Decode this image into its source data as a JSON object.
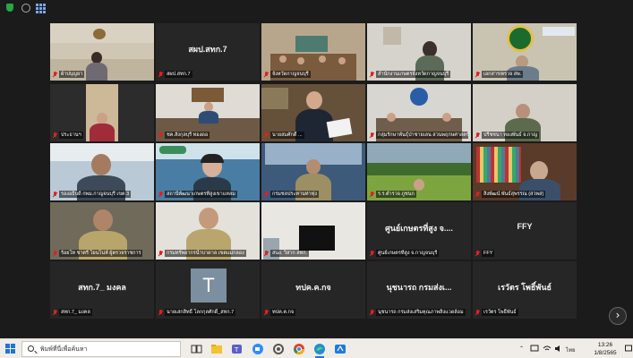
{
  "tiles": [
    {
      "caption": "ผ้าปบุญยา",
      "center": ""
    },
    {
      "caption": "สผป.สทก.7",
      "center": "สผป.สทก.7"
    },
    {
      "caption": "จังหวัดกาญจนบุรี",
      "center": ""
    },
    {
      "caption": "สำนักงานเกษตรจังหวัดกาญจนบุรี",
      "center": ""
    },
    {
      "caption": "เอกสาร/ตรวจ สพ.",
      "center": ""
    },
    {
      "caption": "ประธานฯ",
      "center": ""
    },
    {
      "caption": "ชค.สังกุลบุรี ทองดอ",
      "center": ""
    },
    {
      "caption": "นายสมศักดิ์ ...",
      "center": ""
    },
    {
      "caption": "กลุ่มรักษาพันธุ์ป่าชายเลน สวนพฤกษศาสตร์",
      "center": ""
    },
    {
      "caption": "ปรีชชนา ทองพันธ์ จ.กาญ",
      "center": ""
    },
    {
      "caption": "รองอธิบดี กพม.กาญจนบุรี เขต 3",
      "center": ""
    },
    {
      "caption": "สถานีพัฒนาเกษตรที่สูงเขาแหลม",
      "center": ""
    },
    {
      "caption": "กรมชลประทานท่าทุ่ง",
      "center": ""
    },
    {
      "caption": "ร.ร.ตำรวจ ภูชนก",
      "center": ""
    },
    {
      "caption": "สิงพัฒน์ พันธ์สุพรรณ (สวพส)",
      "center": ""
    },
    {
      "caption": "ร้อยโท ชาตรี โยนโน่ห์ ผู้ตรวจราชการ",
      "center": ""
    },
    {
      "caption": "กรมทรัพยากรน้ำบาดาล เขตแม่กลอง",
      "center": ""
    },
    {
      "caption": "สนง. วิสาก สทก.",
      "center": ""
    },
    {
      "caption": "ศูนย์เกษตรที่สูง จ.กาญจนบุรี",
      "center": "ศูนย์เกษตรที่สูง จ...."
    },
    {
      "caption": "FFY",
      "center": "FFY"
    },
    {
      "caption": "สทก.7_ มงคล",
      "center": "สทก.7_ มงคล"
    },
    {
      "caption": "นายเสกสิทธิ์ โลกกุลศักดิ์_สทก.7",
      "center": ""
    },
    {
      "caption": "ทปค.ค.กจ",
      "center": "ทปค.ค.กจ"
    },
    {
      "caption": "นุชนารถ กรมส่งเสริมคุณภาพสิ่งแวดล้อม",
      "center": "นุชนารถ กรมส่งเ..."
    },
    {
      "caption": "เรวัตร โพธิ์พันธ์",
      "center": "เรวัตร โพธิ์พันธ์"
    }
  ],
  "avatar_letter": "T",
  "next_page_symbol": "›",
  "taskbar": {
    "search_placeholder": "พิมพ์ที่นี่เพื่อค้นหา",
    "language": "ไทย",
    "time": "13:26",
    "date": "1/8/2565"
  },
  "colors": {
    "accent_red_mic": "#e02020",
    "taskbar_bg": "#f0ede8"
  }
}
